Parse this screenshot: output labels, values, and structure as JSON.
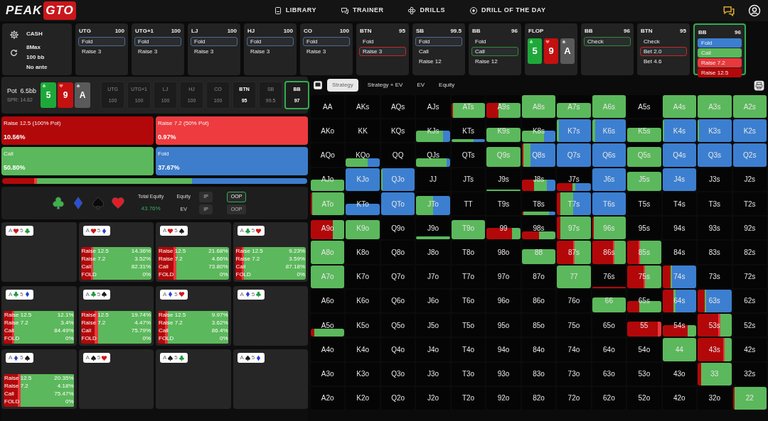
{
  "header": {
    "logo": [
      "PEAK",
      "GTO"
    ],
    "nav": [
      {
        "label": "LIBRARY"
      },
      {
        "label": "TRAINER"
      },
      {
        "label": "DRILLS"
      },
      {
        "label": "DRILL OF THE DAY"
      }
    ]
  },
  "game": {
    "format": "CASH",
    "players": "8Max",
    "stack": "100 bb",
    "ante": "No ante"
  },
  "history": [
    {
      "kind": "seat",
      "position": "UTG",
      "stack": "100",
      "active": false,
      "actions": [
        {
          "label": "Fold",
          "color": "#4d6b96",
          "selected": true
        },
        {
          "label": "Raise 3",
          "selected": false
        }
      ]
    },
    {
      "kind": "seat",
      "position": "UTG+1",
      "stack": "100",
      "active": false,
      "actions": [
        {
          "label": "Fold",
          "color": "#4d6b96",
          "selected": true
        },
        {
          "label": "Raise 3",
          "selected": false
        }
      ]
    },
    {
      "kind": "seat",
      "position": "LJ",
      "stack": "100",
      "active": false,
      "actions": [
        {
          "label": "Fold",
          "color": "#4d6b96",
          "selected": true
        },
        {
          "label": "Raise 3",
          "selected": false
        }
      ]
    },
    {
      "kind": "seat",
      "position": "HJ",
      "stack": "100",
      "active": false,
      "actions": [
        {
          "label": "Fold",
          "color": "#4d6b96",
          "selected": true
        },
        {
          "label": "Raise 3",
          "selected": false
        }
      ]
    },
    {
      "kind": "seat",
      "position": "CO",
      "stack": "100",
      "active": false,
      "actions": [
        {
          "label": "Fold",
          "color": "#4d6b96",
          "selected": true
        },
        {
          "label": "Raise 3",
          "selected": false
        }
      ]
    },
    {
      "kind": "seat",
      "position": "BTN",
      "stack": "95",
      "active": false,
      "actions": [
        {
          "label": "Fold",
          "selected": false
        },
        {
          "label": "Raise 3",
          "color": "#c62828",
          "selected": true
        }
      ]
    },
    {
      "kind": "seat",
      "position": "SB",
      "stack": "99.5",
      "active": false,
      "actions": [
        {
          "label": "Fold",
          "color": "#4d6b96",
          "selected": true
        },
        {
          "label": "Call",
          "selected": false
        },
        {
          "label": "Raise 12",
          "selected": false
        }
      ]
    },
    {
      "kind": "seat",
      "position": "BB",
      "stack": "96",
      "active": false,
      "actions": [
        {
          "label": "Fold",
          "selected": false
        },
        {
          "label": "Call",
          "color": "#2e8a3a",
          "selected": true
        },
        {
          "label": "Raise 12",
          "selected": false
        }
      ]
    },
    {
      "kind": "board",
      "label": "FLOP",
      "cards": [
        {
          "rank": "5",
          "kind": "club"
        },
        {
          "rank": "9",
          "kind": "heart"
        },
        {
          "rank": "A",
          "kind": "spade"
        }
      ]
    },
    {
      "kind": "seat",
      "position": "BB",
      "stack": "96",
      "active": false,
      "actions": [
        {
          "label": "Check",
          "color": "#2e8a3a",
          "selected": true
        }
      ]
    },
    {
      "kind": "seat",
      "position": "BTN",
      "stack": "95",
      "active": false,
      "actions": [
        {
          "label": "Check",
          "selected": false
        },
        {
          "label": "Bet 2.0",
          "color": "#c62828",
          "selected": true
        },
        {
          "label": "Bet 4.6",
          "selected": false
        }
      ]
    },
    {
      "kind": "seat",
      "position": "BB",
      "stack": "96",
      "active": true,
      "actions": [
        {
          "label": "Fold",
          "color": "#3c7fd0",
          "selected": false
        },
        {
          "label": "Call",
          "color": "#5cb85c",
          "selected": false
        },
        {
          "label": "Raise 7.2",
          "color": "#e8393c",
          "selected": false
        },
        {
          "label": "Raise 12.5",
          "color": "#b3080a",
          "selected": false
        }
      ]
    }
  ],
  "pot": {
    "label": "Pot",
    "value": "6.5bb",
    "spr": "SPR: 14.82",
    "board": [
      {
        "rank": "5",
        "kind": "club"
      },
      {
        "rank": "9",
        "kind": "heart"
      },
      {
        "rank": "A",
        "kind": "spade"
      }
    ],
    "seats": [
      {
        "position": "UTG",
        "stack": "100",
        "folded": true,
        "selected": false
      },
      {
        "position": "UTG+1",
        "stack": "100",
        "folded": true,
        "selected": false
      },
      {
        "position": "LJ",
        "stack": "100",
        "folded": true,
        "selected": false
      },
      {
        "position": "HJ",
        "stack": "100",
        "folded": true,
        "selected": false
      },
      {
        "position": "CO",
        "stack": "100",
        "folded": true,
        "selected": false
      },
      {
        "position": "BTN",
        "stack": "95",
        "folded": false,
        "selected": false
      },
      {
        "position": "SB",
        "stack": "99.5",
        "folded": true,
        "selected": false
      },
      {
        "position": "BB",
        "stack": "97",
        "folded": false,
        "selected": true
      }
    ]
  },
  "strategy": [
    {
      "label": "Raise 12.5 (100% Pot)",
      "value": "10.56%",
      "color": "#b3080a"
    },
    {
      "label": "Raise 7.2 (50% Pot)",
      "value": "0.97%",
      "color": "#ee3b3f"
    },
    {
      "label": "Call",
      "value": "50.80%",
      "color": "#5cb85c"
    },
    {
      "label": "Fold",
      "value": "37.67%",
      "color": "#3d7dcc"
    }
  ],
  "equity": {
    "total_label": "Total Equity",
    "total_value": "43.76%",
    "rows": [
      {
        "label": "Equity",
        "options": [
          {
            "label": "IP",
            "selected": false
          },
          {
            "label": "OOP",
            "selected": true
          }
        ]
      },
      {
        "label": "EV",
        "options": [
          {
            "label": "IP",
            "selected": false
          },
          {
            "label": "OOP",
            "selected": false
          }
        ]
      }
    ]
  },
  "combos": [
    {
      "cards": [
        {
          "rank": "A",
          "kind": "heart"
        },
        {
          "rank": "5",
          "kind": "club"
        }
      ]
    },
    {
      "cards": [
        {
          "rank": "A",
          "kind": "heart"
        },
        {
          "rank": "5",
          "kind": "diamond"
        }
      ],
      "lines": [
        {
          "label": "Raise 12.5",
          "value": "14.36%",
          "color": "#b3080a"
        },
        {
          "label": "Raise 7.2",
          "value": "3.52%",
          "color": "#e8393c"
        },
        {
          "label": "Call",
          "value": "82.31%",
          "color": "#5cb85c"
        },
        {
          "label": "FOLD",
          "value": "0%"
        }
      ]
    },
    {
      "cards": [
        {
          "rank": "A",
          "kind": "heart"
        },
        {
          "rank": "5",
          "kind": "spade"
        }
      ],
      "lines": [
        {
          "label": "Raise 12.5",
          "value": "21.68%",
          "color": "#b3080a"
        },
        {
          "label": "Raise 7.2",
          "value": "4.66%",
          "color": "#e8393c"
        },
        {
          "label": "Call",
          "value": "73.80%",
          "color": "#5cb85c"
        },
        {
          "label": "FOLD",
          "value": "0%"
        }
      ]
    },
    {
      "cards": [
        {
          "rank": "A",
          "kind": "club"
        },
        {
          "rank": "5",
          "kind": "heart"
        }
      ],
      "lines": [
        {
          "label": "Raise 12.5",
          "value": "9.23%",
          "color": "#b3080a"
        },
        {
          "label": "Raise 7.2",
          "value": "3.59%",
          "color": "#e8393c"
        },
        {
          "label": "Call",
          "value": "87.18%",
          "color": "#5cb85c"
        },
        {
          "label": "FOLD",
          "value": "0%"
        }
      ]
    },
    {
      "cards": [
        {
          "rank": "A",
          "kind": "club"
        },
        {
          "rank": "5",
          "kind": "diamond"
        }
      ],
      "lines": [
        {
          "label": "Raise 12.5",
          "value": "12.1%",
          "color": "#b3080a"
        },
        {
          "label": "Raise 7.2",
          "value": "3.4%",
          "color": "#e8393c"
        },
        {
          "label": "Call",
          "value": "84.49%",
          "color": "#5cb85c"
        },
        {
          "label": "FOLD",
          "value": "0%"
        }
      ]
    },
    {
      "cards": [
        {
          "rank": "A",
          "kind": "club"
        },
        {
          "rank": "5",
          "kind": "spade"
        }
      ],
      "lines": [
        {
          "label": "Raise 12.5",
          "value": "19.74%",
          "color": "#b3080a"
        },
        {
          "label": "Raise 7.2",
          "value": "4.47%",
          "color": "#e8393c"
        },
        {
          "label": "Call",
          "value": "75.79%",
          "color": "#5cb85c"
        },
        {
          "label": "FOLD",
          "value": "0%"
        }
      ]
    },
    {
      "cards": [
        {
          "rank": "A",
          "kind": "diamond"
        },
        {
          "rank": "5",
          "kind": "heart"
        }
      ],
      "lines": [
        {
          "label": "Raise 12.5",
          "value": "9.97%",
          "color": "#b3080a"
        },
        {
          "label": "Raise 7.2",
          "value": "3.62%",
          "color": "#e8393c"
        },
        {
          "label": "Call",
          "value": "86.4%",
          "color": "#5cb85c"
        },
        {
          "label": "FOLD",
          "value": "0%"
        }
      ]
    },
    {
      "cards": [
        {
          "rank": "A",
          "kind": "diamond"
        },
        {
          "rank": "5",
          "kind": "club"
        }
      ]
    },
    {
      "cards": [
        {
          "rank": "A",
          "kind": "diamond"
        },
        {
          "rank": "5",
          "kind": "spade"
        }
      ],
      "lines": [
        {
          "label": "Raise 12.5",
          "value": "20.35%",
          "color": "#b3080a"
        },
        {
          "label": "Raise 7.2",
          "value": "4.18%",
          "color": "#e8393c"
        },
        {
          "label": "Call",
          "value": "75.47%",
          "color": "#5cb85c"
        },
        {
          "label": "FOLD",
          "value": "0%"
        }
      ]
    },
    {
      "cards": [
        {
          "rank": "A",
          "kind": "spade"
        },
        {
          "rank": "5",
          "kind": "heart"
        }
      ]
    },
    {
      "cards": [
        {
          "rank": "A",
          "kind": "spade"
        },
        {
          "rank": "5",
          "kind": "club"
        }
      ]
    },
    {
      "cards": [
        {
          "rank": "A",
          "kind": "spade"
        },
        {
          "rank": "5",
          "kind": "diamond"
        }
      ]
    }
  ],
  "view_tabs": [
    {
      "label": "Strategy",
      "selected": true
    },
    {
      "label": "Strategy + EV",
      "selected": false
    },
    {
      "label": "EV",
      "selected": false
    },
    {
      "label": "Equity",
      "selected": false
    }
  ],
  "range_grid": {
    "rows": [
      [
        {
          "hand": "AA"
        },
        {
          "hand": "AKs"
        },
        {
          "hand": "AQs"
        },
        {
          "hand": "AJs"
        },
        {
          "hand": "ATs",
          "kind": "high",
          "mix": [
            {
              "color": "#b3080a",
              "kind": "sliver"
            },
            {
              "color": "#5cb85c",
              "kind": "all"
            }
          ]
        },
        {
          "hand": "A9s",
          "kind": "high",
          "mix": [
            {
              "color": "#b3080a",
              "kind": "third"
            },
            {
              "color": "#5cb85c",
              "kind": "most"
            }
          ]
        },
        {
          "hand": "A8s",
          "kind": "full",
          "mix": [
            {
              "color": "#5cb85c"
            }
          ]
        },
        {
          "hand": "A7s",
          "kind": "high",
          "mix": [
            {
              "color": "#5cb85c"
            }
          ]
        },
        {
          "hand": "A6s",
          "kind": "full",
          "mix": [
            {
              "color": "#5cb85c"
            }
          ]
        },
        {
          "hand": "A5s"
        },
        {
          "hand": "A4s",
          "kind": "full",
          "mix": [
            {
              "color": "#5cb85c"
            }
          ]
        },
        {
          "hand": "A3s",
          "kind": "full",
          "mix": [
            {
              "color": "#5cb85c"
            }
          ]
        },
        {
          "hand": "A2s",
          "kind": "full",
          "mix": [
            {
              "color": "#5cb85c"
            }
          ]
        }
      ],
      [
        {
          "hand": "AKo"
        },
        {
          "hand": "KK"
        },
        {
          "hand": "KQs"
        },
        {
          "hand": "KJs",
          "kind": "half",
          "mix": [
            {
              "color": "#5cb85c",
              "kind": "large"
            },
            {
              "color": "#3c7fd0",
              "kind": "fifth"
            }
          ]
        },
        {
          "hand": "KTs",
          "kind": "thin",
          "mix": [
            {
              "color": "#5cb85c",
              "kind": "most"
            },
            {
              "color": "#3c7fd0",
              "kind": "third"
            }
          ]
        },
        {
          "hand": "K9s",
          "kind": "high",
          "mix": [
            {
              "color": "#5cb85c"
            }
          ]
        },
        {
          "hand": "K8s",
          "kind": "half",
          "mix": [
            {
              "color": "#5cb85c",
              "kind": "most"
            },
            {
              "color": "#3c7fd0",
              "kind": "third"
            }
          ]
        },
        {
          "hand": "K7s",
          "kind": "full",
          "mix": [
            {
              "color": "#5cb85c",
              "kind": "sliver"
            },
            {
              "color": "#3c7fd0",
              "kind": "all"
            }
          ]
        },
        {
          "hand": "K6s",
          "kind": "full",
          "mix": [
            {
              "color": "#5cb85c",
              "kind": "tenth"
            },
            {
              "color": "#3c7fd0",
              "kind": "nearly"
            }
          ]
        },
        {
          "hand": "K5s",
          "kind": "high",
          "mix": [
            {
              "color": "#5cb85c"
            }
          ]
        },
        {
          "hand": "K4s",
          "kind": "full",
          "mix": [
            {
              "color": "#5cb85c",
              "kind": "sliver"
            },
            {
              "color": "#3c7fd0",
              "kind": "all"
            }
          ]
        },
        {
          "hand": "K3s",
          "kind": "full",
          "mix": [
            {
              "color": "#5cb85c",
              "kind": "sliver"
            },
            {
              "color": "#3c7fd0",
              "kind": "all"
            }
          ]
        },
        {
          "hand": "K2s",
          "kind": "full",
          "mix": [
            {
              "color": "#3c7fd0"
            }
          ]
        }
      ],
      [
        {
          "hand": "AQo"
        },
        {
          "hand": "KQo",
          "kind": "low",
          "mix": [
            {
              "color": "#5cb85c",
              "kind": "most"
            },
            {
              "color": "#3c7fd0",
              "kind": "third"
            }
          ]
        },
        {
          "hand": "QQ"
        },
        {
          "hand": "QJs",
          "kind": "low",
          "mix": [
            {
              "color": "#5cb85c",
              "kind": "nearly"
            },
            {
              "color": "#3c7fd0",
              "kind": "tenth"
            }
          ]
        },
        {
          "hand": "QTs"
        },
        {
          "hand": "Q9s",
          "kind": "tall",
          "mix": [
            {
              "color": "#5cb85c"
            }
          ]
        },
        {
          "hand": "Q8s",
          "kind": "full",
          "mix": [
            {
              "color": "#b3080a",
              "kind": "sliver"
            },
            {
              "color": "#5cb85c",
              "kind": "fifth"
            },
            {
              "color": "#3c7fd0",
              "kind": "large"
            }
          ]
        },
        {
          "hand": "Q7s",
          "kind": "full",
          "mix": [
            {
              "color": "#3c7fd0"
            }
          ]
        },
        {
          "hand": "Q6s",
          "kind": "full",
          "mix": [
            {
              "color": "#3c7fd0"
            }
          ]
        },
        {
          "hand": "Q5s",
          "kind": "tall",
          "mix": [
            {
              "color": "#5cb85c"
            }
          ]
        },
        {
          "hand": "Q4s",
          "kind": "full",
          "mix": [
            {
              "color": "#3c7fd0"
            }
          ]
        },
        {
          "hand": "Q3s",
          "kind": "full",
          "mix": [
            {
              "color": "#3c7fd0"
            }
          ]
        },
        {
          "hand": "Q2s",
          "kind": "full",
          "mix": [
            {
              "color": "#3c7fd0"
            }
          ]
        }
      ],
      [
        {
          "hand": "AJo",
          "kind": "half",
          "mix": [
            {
              "color": "#5cb85c"
            }
          ]
        },
        {
          "hand": "KJo",
          "kind": "full",
          "mix": [
            {
              "color": "#3c7fd0"
            }
          ]
        },
        {
          "hand": "QJo",
          "kind": "full",
          "mix": [
            {
              "color": "#5cb85c",
              "kind": "sliver"
            },
            {
              "color": "#3c7fd0",
              "kind": "all"
            }
          ]
        },
        {
          "hand": "JJ"
        },
        {
          "hand": "JTs"
        },
        {
          "hand": "J9s",
          "kind": "sliver",
          "mix": [
            {
              "color": "#5cb85c"
            }
          ]
        },
        {
          "hand": "J8s",
          "kind": "half",
          "mix": [
            {
              "color": "#b3080a",
              "kind": "third"
            },
            {
              "color": "#5cb85c",
              "kind": "third"
            },
            {
              "color": "#3c7fd0",
              "kind": "quarter"
            }
          ]
        },
        {
          "hand": "J7s",
          "kind": "low",
          "mix": [
            {
              "color": "#b3080a",
              "kind": "half"
            },
            {
              "color": "#5cb85c",
              "kind": "tenth"
            },
            {
              "color": "#3c7fd0",
              "kind": "half"
            }
          ]
        },
        {
          "hand": "J6s",
          "kind": "full",
          "mix": [
            {
              "color": "#3c7fd0"
            }
          ]
        },
        {
          "hand": "J5s",
          "kind": "tall",
          "mix": [
            {
              "color": "#5cb85c"
            }
          ]
        },
        {
          "hand": "J4s",
          "kind": "full",
          "mix": [
            {
              "color": "#3c7fd0"
            }
          ]
        },
        {
          "hand": "J3s"
        },
        {
          "hand": "J2s"
        }
      ],
      [
        {
          "hand": "ATo",
          "kind": "full",
          "mix": [
            {
              "color": "#b3080a",
              "kind": "sliver"
            },
            {
              "color": "#5cb85c",
              "kind": "all"
            }
          ]
        },
        {
          "hand": "KTo",
          "kind": "half",
          "mix": [
            {
              "color": "#3c7fd0"
            }
          ]
        },
        {
          "hand": "QTo",
          "kind": "full",
          "mix": [
            {
              "color": "#3c7fd0"
            }
          ]
        },
        {
          "hand": "JTo",
          "kind": "tall",
          "mix": [
            {
              "color": "#5cb85c",
              "kind": "half"
            },
            {
              "color": "#3c7fd0",
              "kind": "half"
            }
          ]
        },
        {
          "hand": "TT"
        },
        {
          "hand": "T9s"
        },
        {
          "hand": "T8s",
          "kind": "thin",
          "mix": [
            {
              "color": "#b3080a",
              "kind": "sliver"
            },
            {
              "color": "#5cb85c",
              "kind": "large"
            },
            {
              "color": "#3c7fd0",
              "kind": "fifth"
            }
          ]
        },
        {
          "hand": "T7s",
          "kind": "full",
          "mix": [
            {
              "color": "#b3080a",
              "kind": "tenth"
            },
            {
              "color": "#5cb85c",
              "kind": "third"
            },
            {
              "color": "#3c7fd0",
              "kind": "half"
            }
          ]
        },
        {
          "hand": "T6s",
          "kind": "full",
          "mix": [
            {
              "color": "#3c7fd0"
            }
          ]
        },
        {
          "hand": "T5s"
        },
        {
          "hand": "T4s"
        },
        {
          "hand": "T3s"
        },
        {
          "hand": "T2s"
        }
      ],
      [
        {
          "hand": "A9o",
          "kind": "tall",
          "mix": [
            {
              "color": "#b3080a",
              "kind": "most"
            },
            {
              "color": "#5cb85c",
              "kind": "third"
            }
          ]
        },
        {
          "hand": "K9o",
          "kind": "tall",
          "mix": [
            {
              "color": "#5cb85c"
            }
          ]
        },
        {
          "hand": "Q9o"
        },
        {
          "hand": "J9o",
          "kind": "thin",
          "mix": [
            {
              "color": "#5cb85c"
            }
          ]
        },
        {
          "hand": "T9o",
          "kind": "tall",
          "mix": [
            {
              "color": "#5cb85c"
            }
          ]
        },
        {
          "hand": "99",
          "kind": "half",
          "mix": [
            {
              "color": "#b3080a",
              "kind": "large"
            },
            {
              "color": "#5cb85c",
              "kind": "quarter"
            }
          ]
        },
        {
          "hand": "98s",
          "kind": "low",
          "mix": [
            {
              "color": "#b3080a",
              "kind": "half"
            },
            {
              "color": "#5cb85c",
              "kind": "half"
            }
          ]
        },
        {
          "hand": "97s",
          "kind": "full",
          "mix": [
            {
              "color": "#b3080a",
              "kind": "tenth"
            },
            {
              "color": "#5cb85c",
              "kind": "nearly"
            }
          ]
        },
        {
          "hand": "96s",
          "kind": "full",
          "mix": [
            {
              "color": "#b3080a",
              "kind": "sliver"
            },
            {
              "color": "#5cb85c",
              "kind": "all"
            }
          ]
        },
        {
          "hand": "95s"
        },
        {
          "hand": "94s"
        },
        {
          "hand": "93s"
        },
        {
          "hand": "92s"
        }
      ],
      [
        {
          "hand": "A8o",
          "kind": "full",
          "mix": [
            {
              "color": "#5cb85c"
            }
          ]
        },
        {
          "hand": "K8o"
        },
        {
          "hand": "Q8o"
        },
        {
          "hand": "J8o"
        },
        {
          "hand": "T8o"
        },
        {
          "hand": "98o"
        },
        {
          "hand": "88",
          "kind": "high",
          "mix": [
            {
              "color": "#5cb85c"
            }
          ]
        },
        {
          "hand": "87s",
          "kind": "full",
          "mix": [
            {
              "color": "#b3080a",
              "kind": "half"
            },
            {
              "color": "#e8393c",
              "kind": "sliver"
            },
            {
              "color": "#5cb85c",
              "kind": "half"
            }
          ]
        },
        {
          "hand": "86s",
          "kind": "full",
          "mix": [
            {
              "color": "#b3080a",
              "kind": "most"
            },
            {
              "color": "#e8393c",
              "kind": "sliver"
            },
            {
              "color": "#5cb85c",
              "kind": "third"
            }
          ]
        },
        {
          "hand": "85s",
          "kind": "full",
          "mix": [
            {
              "color": "#b3080a",
              "kind": "third"
            },
            {
              "color": "#e8393c",
              "kind": "sliver"
            },
            {
              "color": "#5cb85c",
              "kind": "most"
            }
          ]
        },
        {
          "hand": "84s"
        },
        {
          "hand": "83s"
        },
        {
          "hand": "82s"
        }
      ],
      [
        {
          "hand": "A7o",
          "kind": "full",
          "mix": [
            {
              "color": "#5cb85c"
            }
          ]
        },
        {
          "hand": "K7o"
        },
        {
          "hand": "Q7o"
        },
        {
          "hand": "J7o"
        },
        {
          "hand": "T7o"
        },
        {
          "hand": "97o"
        },
        {
          "hand": "87o"
        },
        {
          "hand": "77",
          "kind": "full",
          "mix": [
            {
              "color": "#5cb85c"
            }
          ]
        },
        {
          "hand": "76s",
          "kind": "sliver",
          "mix": [
            {
              "color": "#b3080a"
            }
          ]
        },
        {
          "hand": "75s",
          "kind": "full",
          "mix": [
            {
              "color": "#b3080a",
              "kind": "half"
            },
            {
              "color": "#e8393c",
              "kind": "sliver"
            },
            {
              "color": "#5cb85c",
              "kind": "half"
            }
          ]
        },
        {
          "hand": "74s",
          "kind": "full",
          "mix": [
            {
              "color": "#b3080a",
              "kind": "quarter"
            },
            {
              "color": "#5cb85c",
              "kind": "sliver"
            },
            {
              "color": "#3c7fd0",
              "kind": "large"
            }
          ]
        },
        {
          "hand": "73s"
        },
        {
          "hand": "72s"
        }
      ],
      [
        {
          "hand": "A6o"
        },
        {
          "hand": "K6o"
        },
        {
          "hand": "Q6o"
        },
        {
          "hand": "J6o"
        },
        {
          "hand": "T6o"
        },
        {
          "hand": "96o"
        },
        {
          "hand": "86o"
        },
        {
          "hand": "76o"
        },
        {
          "hand": "66",
          "kind": "high",
          "mix": [
            {
              "color": "#5cb85c"
            }
          ]
        },
        {
          "hand": "65s",
          "kind": "half",
          "mix": [
            {
              "color": "#b3080a",
              "kind": "third"
            },
            {
              "color": "#5cb85c",
              "kind": "most"
            }
          ]
        },
        {
          "hand": "64s",
          "kind": "full",
          "mix": [
            {
              "color": "#b3080a",
              "kind": "third"
            },
            {
              "color": "#5cb85c",
              "kind": "sliver"
            },
            {
              "color": "#3c7fd0",
              "kind": "most"
            }
          ]
        },
        {
          "hand": "63s",
          "kind": "full",
          "mix": [
            {
              "color": "#b3080a",
              "kind": "fifth"
            },
            {
              "color": "#5cb85c",
              "kind": "sliver"
            },
            {
              "color": "#3c7fd0",
              "kind": "large"
            }
          ]
        },
        {
          "hand": "62s"
        }
      ],
      [
        {
          "hand": "A5o",
          "kind": "low",
          "mix": [
            {
              "color": "#b3080a",
              "kind": "tenth"
            },
            {
              "color": "#5cb85c",
              "kind": "nearly"
            }
          ]
        },
        {
          "hand": "K5o"
        },
        {
          "hand": "Q5o"
        },
        {
          "hand": "J5o"
        },
        {
          "hand": "T5o"
        },
        {
          "hand": "95o"
        },
        {
          "hand": "85o"
        },
        {
          "hand": "75o"
        },
        {
          "hand": "65o"
        },
        {
          "hand": "55",
          "kind": "high",
          "mix": [
            {
              "color": "#b3080a",
              "kind": "nearly"
            },
            {
              "color": "#e8393c",
              "kind": "tenth"
            }
          ]
        },
        {
          "hand": "54s",
          "kind": "half",
          "mix": [
            {
              "color": "#b3080a",
              "kind": "large"
            },
            {
              "color": "#5cb85c",
              "kind": "quarter"
            }
          ]
        },
        {
          "hand": "53s",
          "kind": "full",
          "mix": [
            {
              "color": "#b3080a",
              "kind": "most"
            },
            {
              "color": "#e8393c",
              "kind": "sliver"
            },
            {
              "color": "#5cb85c",
              "kind": "third"
            }
          ]
        },
        {
          "hand": "52s"
        }
      ],
      [
        {
          "hand": "A4o"
        },
        {
          "hand": "K4o"
        },
        {
          "hand": "Q4o"
        },
        {
          "hand": "J4o"
        },
        {
          "hand": "T4o"
        },
        {
          "hand": "94o"
        },
        {
          "hand": "84o"
        },
        {
          "hand": "74o"
        },
        {
          "hand": "64o"
        },
        {
          "hand": "54o"
        },
        {
          "hand": "44",
          "kind": "full",
          "mix": [
            {
              "color": "#5cb85c"
            }
          ]
        },
        {
          "hand": "43s",
          "kind": "full",
          "mix": [
            {
              "color": "#b3080a",
              "kind": "large"
            },
            {
              "color": "#e8393c",
              "kind": "sliver"
            },
            {
              "color": "#5cb85c",
              "kind": "fifth"
            }
          ]
        },
        {
          "hand": "42s"
        }
      ],
      [
        {
          "hand": "A3o"
        },
        {
          "hand": "K3o"
        },
        {
          "hand": "Q3o"
        },
        {
          "hand": "J3o"
        },
        {
          "hand": "T3o"
        },
        {
          "hand": "93o"
        },
        {
          "hand": "83o"
        },
        {
          "hand": "73o"
        },
        {
          "hand": "63o"
        },
        {
          "hand": "53o"
        },
        {
          "hand": "43o"
        },
        {
          "hand": "33",
          "kind": "full",
          "mix": [
            {
              "color": "#b3080a",
              "kind": "tenth"
            },
            {
              "color": "#5cb85c",
              "kind": "nearly"
            }
          ]
        },
        {
          "hand": "32s"
        }
      ],
      [
        {
          "hand": "A2o"
        },
        {
          "hand": "K2o"
        },
        {
          "hand": "Q2o"
        },
        {
          "hand": "J2o"
        },
        {
          "hand": "T2o"
        },
        {
          "hand": "92o"
        },
        {
          "hand": "82o"
        },
        {
          "hand": "72o"
        },
        {
          "hand": "62o"
        },
        {
          "hand": "52o"
        },
        {
          "hand": "42o"
        },
        {
          "hand": "32o"
        },
        {
          "hand": "22",
          "kind": "full",
          "mix": [
            {
              "color": "#b3080a",
              "kind": "sliver"
            },
            {
              "color": "#5cb85c",
              "kind": "all"
            }
          ]
        }
      ]
    ]
  }
}
